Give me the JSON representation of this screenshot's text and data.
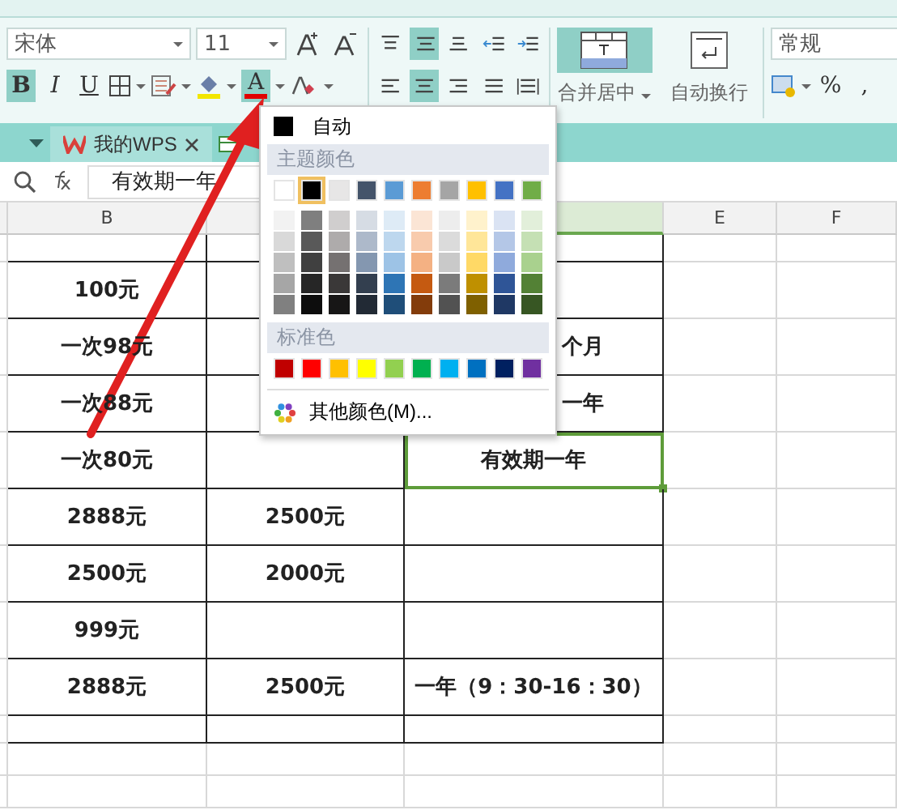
{
  "ribbon": {
    "font_name": "宋体",
    "font_size": "11",
    "format_buttons": [
      {
        "label": "B",
        "active": true
      },
      {
        "label": "I",
        "active": false
      },
      {
        "label": "U",
        "active": false
      }
    ],
    "font_color_button": {
      "label": "A",
      "active": true
    },
    "align_buttons": [
      {
        "kind": "top",
        "active": false
      },
      {
        "kind": "middle",
        "active": true
      },
      {
        "kind": "bottom",
        "active": false
      },
      {
        "kind": "outdent",
        "active": false
      },
      {
        "kind": "indent",
        "active": false
      },
      {
        "kind": "left",
        "active": false
      },
      {
        "kind": "center",
        "active": true
      },
      {
        "kind": "right",
        "active": false
      },
      {
        "kind": "justify",
        "active": false
      },
      {
        "kind": "distribute",
        "active": false
      }
    ],
    "merge_button": {
      "label": "合并居中",
      "active": true
    },
    "wrap_button": {
      "label": "自动换行",
      "active": false
    },
    "number_format": "常规",
    "percent_label": "%",
    "comma_label": ","
  },
  "tabs": [
    {
      "label": "我的WPS",
      "selected": true
    }
  ],
  "formula_bar": {
    "value": "有效期一年"
  },
  "columns": [
    {
      "label": "B",
      "selected": false
    },
    {
      "selected": false
    },
    {
      "selected": true
    },
    {
      "label": "E",
      "selected": false
    },
    {
      "label": "F",
      "selected": false
    }
  ],
  "rows": [
    {
      "cells": [
        {
          "selected": false
        },
        {
          "selected": false
        },
        {
          "selected": false
        }
      ]
    },
    {
      "cells": [
        {
          "text": "100元",
          "selected": false
        },
        {
          "selected": false
        },
        {
          "selected": false
        }
      ]
    },
    {
      "cells": [
        {
          "text": "一次98元",
          "selected": false
        },
        {
          "selected": false
        },
        {
          "text": "个月",
          "partly_covered": true,
          "selected": false
        }
      ]
    },
    {
      "cells": [
        {
          "text": "一次88元",
          "selected": false
        },
        {
          "selected": false
        },
        {
          "text": "一年",
          "partly_covered": true,
          "selected": false
        }
      ]
    },
    {
      "cells": [
        {
          "text": "一次80元",
          "selected": false
        },
        {
          "selected": false
        },
        {
          "text": "有效期一年",
          "selected": true
        }
      ]
    },
    {
      "cells": [
        {
          "text": "2888元",
          "selected": false
        },
        {
          "text": "2500元",
          "selected": false
        },
        {
          "selected": false
        }
      ]
    },
    {
      "cells": [
        {
          "text": "2500元",
          "selected": false
        },
        {
          "text": "2000元",
          "selected": false
        },
        {
          "selected": false
        }
      ]
    },
    {
      "cells": [
        {
          "text": "999元",
          "selected": false
        },
        {
          "selected": false
        },
        {
          "selected": false
        }
      ]
    },
    {
      "cells": [
        {
          "text": "2888元",
          "selected": false
        },
        {
          "text": "2500元",
          "selected": false
        },
        {
          "text": "一年（9：30-16：30）",
          "selected": false
        }
      ]
    },
    {
      "cells": [
        {
          "selected": false
        },
        {
          "selected": false
        },
        {
          "selected": false
        }
      ]
    }
  ],
  "color_menu": {
    "automatic_label": "自动",
    "theme_heading": "主题颜色",
    "theme_colors": [
      {
        "color": "#ffffff",
        "selected": false
      },
      {
        "color": "#000000",
        "selected": true
      },
      {
        "color": "#e7e6e6",
        "selected": false
      },
      {
        "color": "#44546a",
        "selected": false
      },
      {
        "color": "#5b9bd5",
        "selected": false
      },
      {
        "color": "#ed7d31",
        "selected": false
      },
      {
        "color": "#a5a5a5",
        "selected": false
      },
      {
        "color": "#ffc000",
        "selected": false
      },
      {
        "color": "#4472c4",
        "selected": false
      },
      {
        "color": "#70ad47",
        "selected": false
      }
    ],
    "shade_rows": [
      [
        {
          "color": "#f2f2f2"
        },
        {
          "color": "#7f7f7f"
        },
        {
          "color": "#d0cece"
        },
        {
          "color": "#d6dce4"
        },
        {
          "color": "#deebf6"
        },
        {
          "color": "#fbe5d5"
        },
        {
          "color": "#ededed"
        },
        {
          "color": "#fff2cc"
        },
        {
          "color": "#dae3f3"
        },
        {
          "color": "#e2efda"
        }
      ],
      [
        {
          "color": "#d9d9d9"
        },
        {
          "color": "#595959"
        },
        {
          "color": "#aeabab"
        },
        {
          "color": "#adb9ca"
        },
        {
          "color": "#bdd7ee"
        },
        {
          "color": "#f8cbad"
        },
        {
          "color": "#dbdbdb"
        },
        {
          "color": "#ffe699"
        },
        {
          "color": "#b4c7e7"
        },
        {
          "color": "#c5e0b4"
        }
      ],
      [
        {
          "color": "#bfbfbf"
        },
        {
          "color": "#404040"
        },
        {
          "color": "#757171"
        },
        {
          "color": "#8497b0"
        },
        {
          "color": "#9dc3e6"
        },
        {
          "color": "#f4b183"
        },
        {
          "color": "#c9c9c9"
        },
        {
          "color": "#ffd966"
        },
        {
          "color": "#8faadc"
        },
        {
          "color": "#a9d18e"
        }
      ],
      [
        {
          "color": "#a6a6a6"
        },
        {
          "color": "#262626"
        },
        {
          "color": "#3a3838"
        },
        {
          "color": "#333f4f"
        },
        {
          "color": "#2e75b5"
        },
        {
          "color": "#c55a11"
        },
        {
          "color": "#7b7b7b"
        },
        {
          "color": "#bf9000"
        },
        {
          "color": "#2f5597"
        },
        {
          "color": "#538135"
        }
      ],
      [
        {
          "color": "#808080"
        },
        {
          "color": "#0d0d0d"
        },
        {
          "color": "#171616"
        },
        {
          "color": "#222a35"
        },
        {
          "color": "#1f4e79"
        },
        {
          "color": "#833c0b"
        },
        {
          "color": "#525252"
        },
        {
          "color": "#7f6000"
        },
        {
          "color": "#1f3864"
        },
        {
          "color": "#375623"
        }
      ]
    ],
    "standard_heading": "标准色",
    "standard_colors": [
      {
        "color": "#c00000"
      },
      {
        "color": "#ff0000"
      },
      {
        "color": "#ffc000"
      },
      {
        "color": "#ffff00"
      },
      {
        "color": "#92d050"
      },
      {
        "color": "#00b050"
      },
      {
        "color": "#00b0f0"
      },
      {
        "color": "#0070c0"
      },
      {
        "color": "#002060"
      },
      {
        "color": "#7030a0"
      }
    ],
    "more_label": "其他颜色(M)..."
  }
}
